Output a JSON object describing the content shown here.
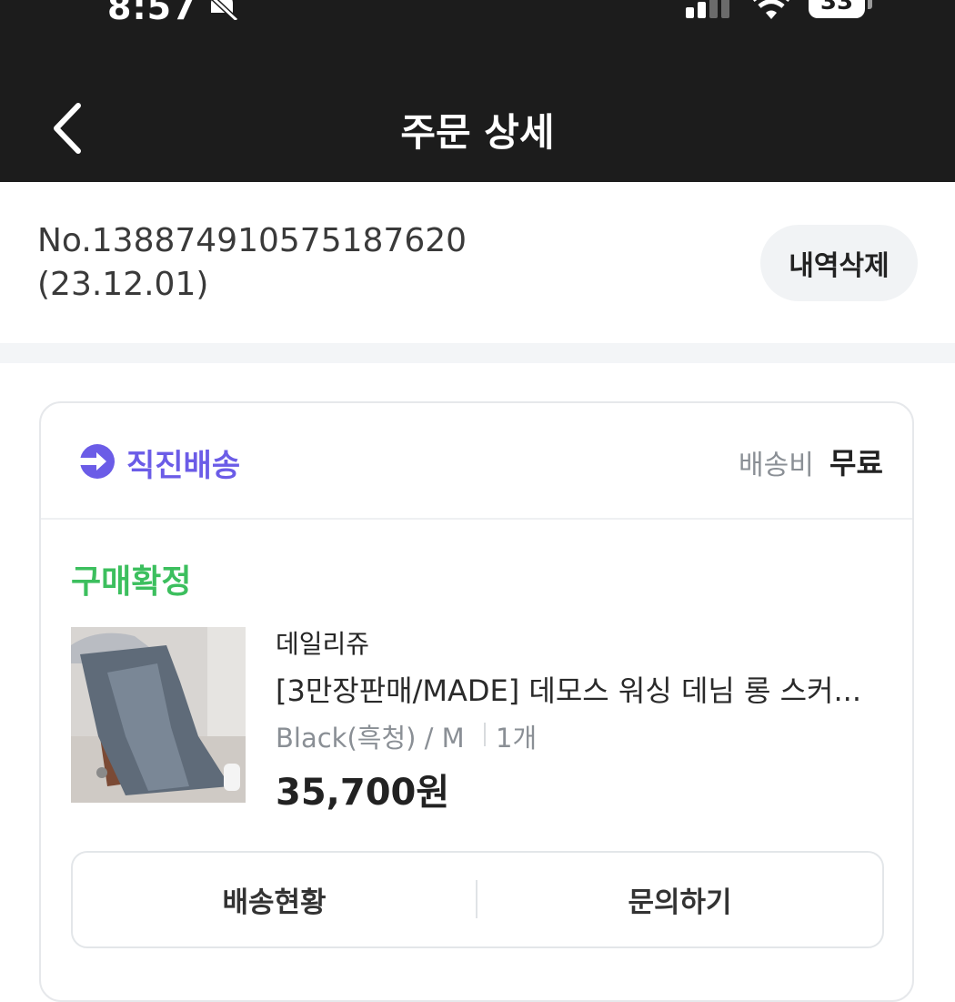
{
  "status_bar": {
    "time": "8:57",
    "battery": "33",
    "icons": [
      "bell-slash-icon",
      "signal-icon",
      "wifi-icon",
      "battery-icon"
    ]
  },
  "header": {
    "title": "주문 상세",
    "back_icon": "chevron-left-icon"
  },
  "order": {
    "number": "No.13887491057518762​0",
    "date": "(23.12.01)",
    "delete_label": "내역삭제"
  },
  "shipping": {
    "label": "직진배송",
    "fee_label": "배송비",
    "fee_value": "무료",
    "icon": "arrow-circle-right-icon",
    "accent": "#6b5ce7"
  },
  "item": {
    "status": "구매확정",
    "status_color": "#3cbf5e",
    "brand": "데일리쥬",
    "name": "[3만장판매/MADE] 데모스 워싱 데님 롱 스커...",
    "option": "Black(흑청) / M",
    "quantity": "1개",
    "price": "35,700원"
  },
  "actions": {
    "track_label": "배송현황",
    "inquiry_label": "문의하기"
  }
}
